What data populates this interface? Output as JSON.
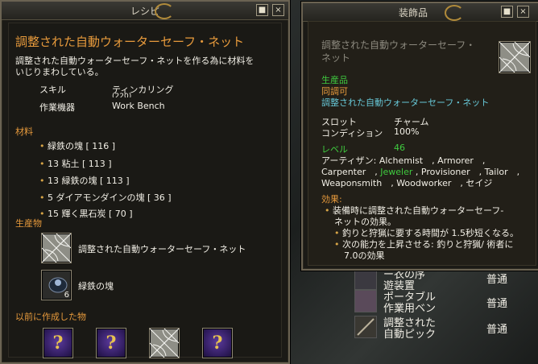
{
  "recipe_window": {
    "title": "レシピ",
    "item_name": "調整された自動ウォーターセーフ・ネット",
    "description_line1": "調整された自動ウォーターセーフ・ネットを作る為に材料を",
    "description_line2": "いじりまわしている。",
    "skill_label": "スキル",
    "skill_value": "ティンカリング",
    "skill_level_partial": "(220)",
    "device_label": "作業機器",
    "device_value": "Work Bench",
    "materials_header": "材料",
    "materials": [
      "緑鉄の塊 [ 116 ]",
      "13 粘土 [ 113 ]",
      "13 緑鉄の塊 [ 113 ]",
      "5 ダイアモンダインの塊 [ 36 ]",
      "15 輝く黒石炭 [ 70 ]"
    ],
    "products_header": "生産物",
    "products": [
      {
        "name": "調整された自動ウォーターセーフ・ネット",
        "count": ""
      },
      {
        "name": "緑鉄の塊",
        "count": "6"
      }
    ],
    "previous_header": "以前に作成した物",
    "previous_items": [
      "?",
      "?",
      "web",
      "?"
    ],
    "minimize_label": "■",
    "close_label": "×"
  },
  "ornament_window": {
    "title": "装飾品",
    "item_name_line1": "調整された自動ウォーターセーフ・",
    "item_name_line2": "ネット",
    "tag_product": "生産品",
    "tag_same_kind": "同調可",
    "tag_link": "調整された自動ウォーターセーフ・ネット",
    "slot_label": "スロット",
    "slot_value": "チャーム",
    "condition_label": "コンディション",
    "condition_value": "100%",
    "level_label": "レベル",
    "level_value": "46",
    "artisan_label": "アーティザン:",
    "artisan_line1_rest": " Alchemist　, Armorer　,",
    "artisan_line2_a": "Carpenter　,",
    "artisan_line2_b": "Jeweler",
    "artisan_line2_c": " , Provisioner　, Tailor　,",
    "artisan_line3": "Weaponsmith　, Woodworker　, セイジ",
    "effect_header": "効果:",
    "effect_main_line1": "装備時に調整された自動ウォーターセーフ-",
    "effect_main_line2": "ネットの効果。",
    "effect_sub1": "釣りと狩猟に要する時間が 1.5秒短くなる。",
    "effect_sub2_line1": "次の能力を上昇させる: 釣りと狩猟/ 術者に",
    "effect_sub2_line2": "7.0の効果",
    "minimize_label": "■",
    "close_label": "×"
  },
  "behind_list": [
    {
      "line1": "ー衣の序",
      "line2": "遊装置",
      "quality": "普通"
    },
    {
      "line1": "ポータブル",
      "line2": "作業用ベン",
      "quality": "普通"
    },
    {
      "line1": "調整された",
      "line2": "自動ピック",
      "quality": "普通"
    }
  ],
  "colors": {
    "accent_orange": "#e79a3c",
    "link_cyan": "#67c7d6",
    "green": "#3fcb3f",
    "frame_gold": "#b08a3a"
  }
}
